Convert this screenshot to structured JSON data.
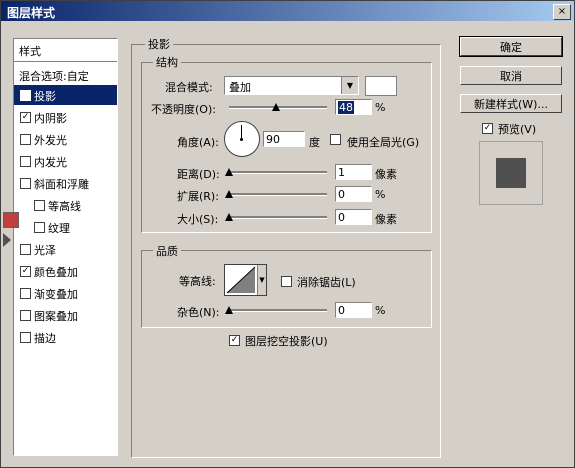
{
  "window": {
    "title": "图层样式",
    "close": "×"
  },
  "sidebar": {
    "header": "样式",
    "blend_options": "混合选项:自定",
    "items": [
      {
        "label": "投影",
        "checked": true,
        "selected": true
      },
      {
        "label": "内阴影",
        "checked": true
      },
      {
        "label": "外发光",
        "checked": false
      },
      {
        "label": "内发光",
        "checked": false
      },
      {
        "label": "斜面和浮雕",
        "checked": false
      },
      {
        "label": "等高线",
        "checked": false,
        "indent": true
      },
      {
        "label": "纹理",
        "checked": false,
        "indent": true
      },
      {
        "label": "光泽",
        "checked": false
      },
      {
        "label": "颜色叠加",
        "checked": true
      },
      {
        "label": "渐变叠加",
        "checked": false
      },
      {
        "label": "图案叠加",
        "checked": false
      },
      {
        "label": "描边",
        "checked": false
      }
    ]
  },
  "main": {
    "section_title": "投影",
    "structure": {
      "title": "结构",
      "blend_mode_label": "混合模式:",
      "blend_mode_value": "叠加",
      "opacity_label": "不透明度(O):",
      "opacity_value": "48",
      "opacity_unit": "%",
      "opacity_fraction": 0.48,
      "angle_label": "角度(A):",
      "angle_value": "90",
      "angle_unit": "度",
      "global_light_label": "使用全局光(G)",
      "global_light_checked": false,
      "distance_label": "距离(D):",
      "distance_value": "1",
      "distance_unit": "像素",
      "spread_label": "扩展(R):",
      "spread_value": "0",
      "spread_unit": "%",
      "size_label": "大小(S):",
      "size_value": "0",
      "size_unit": "像素"
    },
    "quality": {
      "title": "品质",
      "contour_label": "等高线:",
      "antialias_label": "消除锯齿(L)",
      "antialias_checked": false,
      "noise_label": "杂色(N):",
      "noise_value": "0",
      "noise_unit": "%"
    },
    "knockout_label": "图层挖空投影(U)",
    "knockout_checked": true
  },
  "buttons": {
    "ok": "确定",
    "cancel": "取消",
    "new_style": "新建样式(W)...",
    "preview_label": "预览(V)",
    "preview_checked": true
  }
}
